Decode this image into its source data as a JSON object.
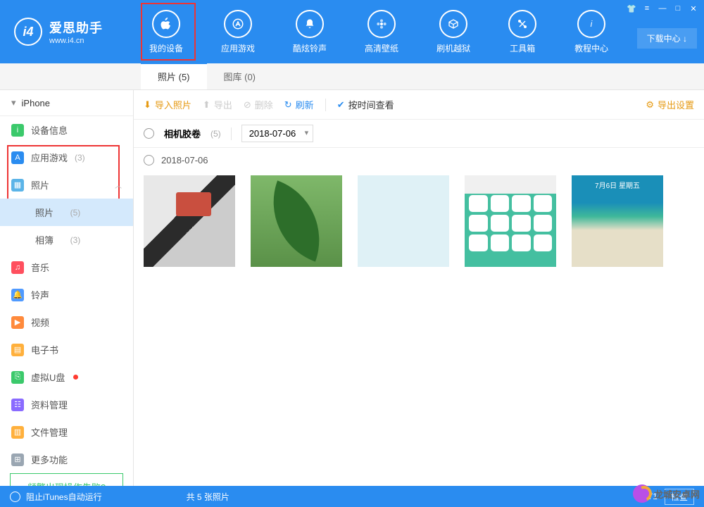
{
  "brand": {
    "title": "爱思助手",
    "subtitle": "www.i4.cn"
  },
  "nav": {
    "device": "我的设备",
    "apps": "应用游戏",
    "ringtones": "酷炫铃声",
    "wallpapers": "高清壁纸",
    "jailbreak": "刷机越狱",
    "toolbox": "工具箱",
    "tutorial": "教程中心"
  },
  "download_center": "下载中心 ↓",
  "tabs": {
    "photos": "照片 (5)",
    "gallery": "图库  (0)"
  },
  "device_name": "iPhone",
  "sidebar": {
    "info": "设备信息",
    "apps": "应用游戏",
    "apps_count": "(3)",
    "photos": "照片",
    "photos_sub": "照片",
    "photos_sub_count": "(5)",
    "albums_sub": "相簿",
    "albums_sub_count": "(3)",
    "music": "音乐",
    "ringtone": "铃声",
    "video": "视频",
    "ebook": "电子书",
    "udisk": "虚拟U盘",
    "data": "资料管理",
    "file": "文件管理",
    "more": "更多功能"
  },
  "help_link": "频繁出现操作失败?",
  "toolbar": {
    "import": "导入照片",
    "export": "导出",
    "delete": "删除",
    "refresh": "刷新",
    "view_by_time": "按时间查看",
    "export_settings": "导出设置"
  },
  "filter": {
    "camera_roll": "相机胶卷",
    "camera_count": "(5)",
    "date": "2018-07-06"
  },
  "group_date": "2018-07-06",
  "thumb5_text": "7月6日 星期五",
  "footer": {
    "itunes": "阻止iTunes自动运行",
    "count": "共 5 张照片",
    "version": "V7.71",
    "check": "检查"
  },
  "watermark": "龙城安卓网"
}
